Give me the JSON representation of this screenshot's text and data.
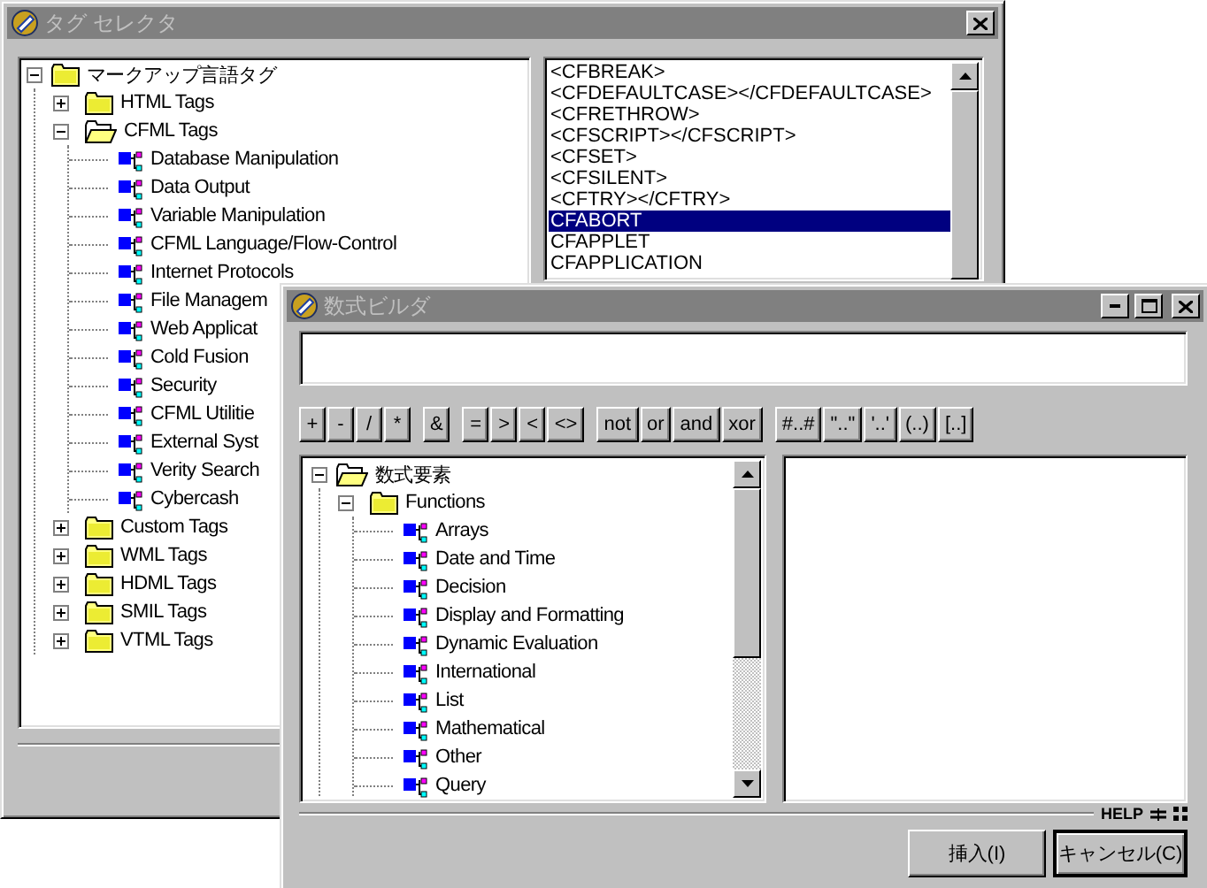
{
  "tag_selector": {
    "title": "タグ セレクタ",
    "tree": [
      {
        "label": "マークアップ言語タグ",
        "kind": "folder",
        "expanded": true,
        "children": [
          {
            "label": "HTML Tags",
            "kind": "folder",
            "expanded": false
          },
          {
            "label": "CFML Tags",
            "kind": "open_folder",
            "expanded": true,
            "children": [
              {
                "label": "Database Manipulation",
                "kind": "item"
              },
              {
                "label": "Data Output",
                "kind": "item"
              },
              {
                "label": "Variable Manipulation",
                "kind": "item"
              },
              {
                "label": "CFML Language/Flow-Control",
                "kind": "item"
              },
              {
                "label": "Internet Protocols",
                "kind": "item"
              },
              {
                "label": "File Managem",
                "kind": "item"
              },
              {
                "label": "Web Applicat",
                "kind": "item"
              },
              {
                "label": "Cold Fusion",
                "kind": "item"
              },
              {
                "label": "Security",
                "kind": "item"
              },
              {
                "label": "CFML Utilitie",
                "kind": "item"
              },
              {
                "label": "External Syst",
                "kind": "item"
              },
              {
                "label": "Verity Search",
                "kind": "item"
              },
              {
                "label": "Cybercash",
                "kind": "item"
              }
            ]
          },
          {
            "label": "Custom Tags",
            "kind": "folder",
            "expanded": false
          },
          {
            "label": "WML Tags",
            "kind": "folder",
            "expanded": false
          },
          {
            "label": "HDML Tags",
            "kind": "folder",
            "expanded": false
          },
          {
            "label": "SMIL Tags",
            "kind": "folder",
            "expanded": false
          },
          {
            "label": "VTML Tags",
            "kind": "folder",
            "expanded": false
          }
        ]
      }
    ],
    "tag_list": [
      {
        "label": "<CFBREAK>",
        "selected": false
      },
      {
        "label": "<CFDEFAULTCASE></CFDEFAULTCASE>",
        "selected": false
      },
      {
        "label": "<CFRETHROW>",
        "selected": false
      },
      {
        "label": "<CFSCRIPT></CFSCRIPT>",
        "selected": false
      },
      {
        "label": "<CFSET>",
        "selected": false
      },
      {
        "label": "<CFSILENT>",
        "selected": false
      },
      {
        "label": "<CFTRY></CFTRY>",
        "selected": false
      },
      {
        "label": "CFABORT",
        "selected": true
      },
      {
        "label": "CFAPPLET",
        "selected": false
      },
      {
        "label": "CFAPPLICATION",
        "selected": false
      }
    ]
  },
  "expression_builder": {
    "title": "数式ビルダ",
    "operator_groups": [
      [
        "+",
        "-",
        "/",
        "*"
      ],
      [
        "&"
      ],
      [
        "=",
        ">",
        "<",
        "<>"
      ],
      [
        "not",
        "or",
        "and",
        "xor"
      ],
      [
        "#..#",
        "\"..\"",
        "'..'",
        "(..)",
        "[..]"
      ]
    ],
    "tree": [
      {
        "label": "数式要素",
        "kind": "open_folder",
        "expanded": true,
        "children": [
          {
            "label": "Functions",
            "kind": "folder",
            "expanded": true,
            "children": [
              {
                "label": "Arrays",
                "kind": "item"
              },
              {
                "label": "Date and Time",
                "kind": "item"
              },
              {
                "label": "Decision",
                "kind": "item"
              },
              {
                "label": "Display and Formatting",
                "kind": "item"
              },
              {
                "label": "Dynamic Evaluation",
                "kind": "item"
              },
              {
                "label": "International",
                "kind": "item"
              },
              {
                "label": "List",
                "kind": "item"
              },
              {
                "label": "Mathematical",
                "kind": "item"
              },
              {
                "label": "Other",
                "kind": "item"
              },
              {
                "label": "Query",
                "kind": "item"
              }
            ]
          }
        ]
      }
    ],
    "status": "HELP",
    "buttons": [
      {
        "label": "挿入(I)",
        "focused": false
      },
      {
        "label": "キャンセル(C)",
        "focused": true
      }
    ]
  }
}
